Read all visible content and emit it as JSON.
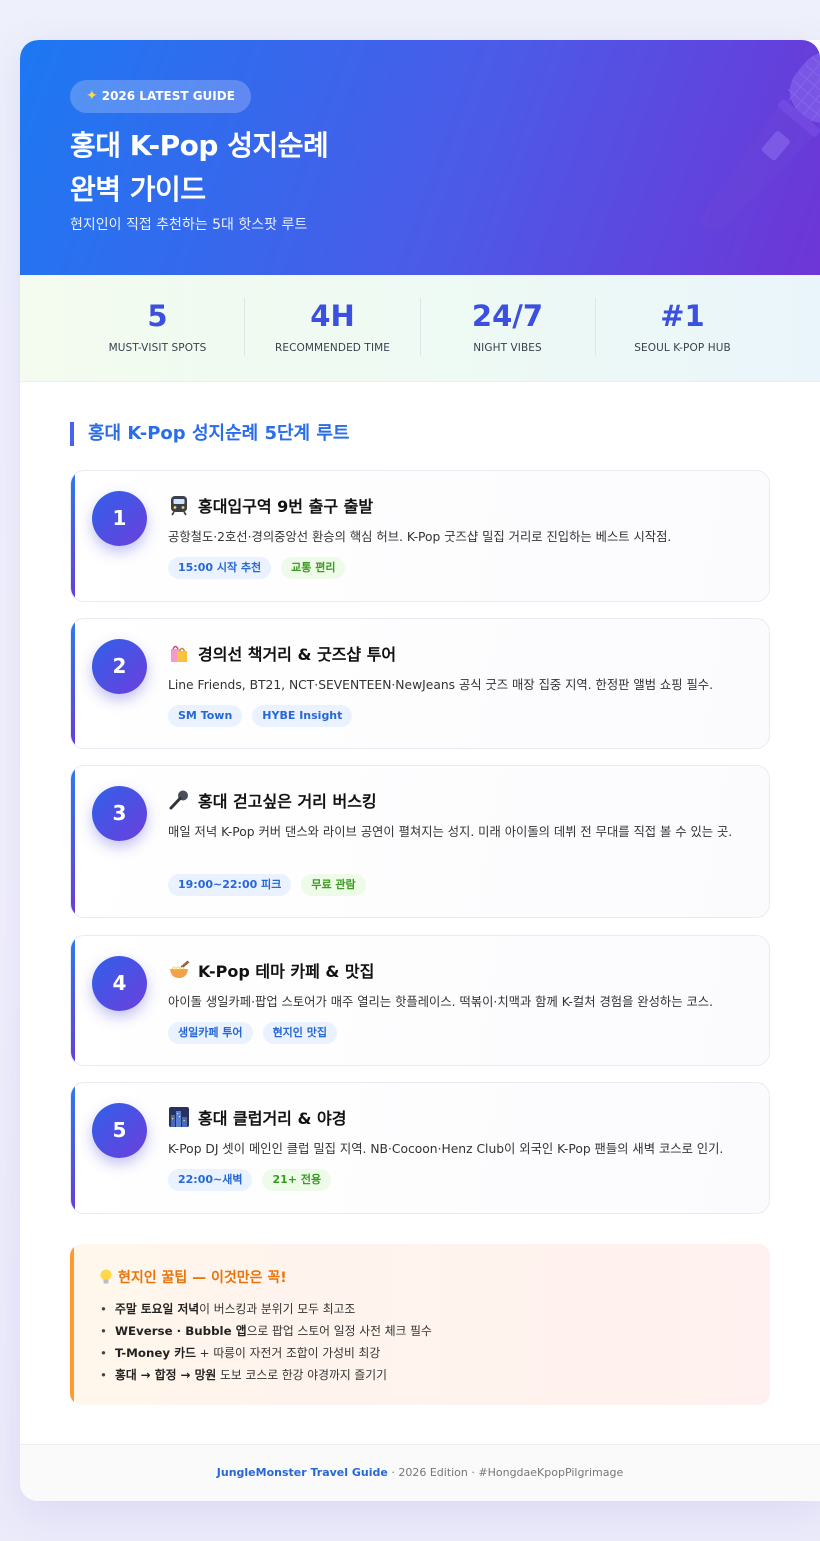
{
  "hero": {
    "badge": "2026 LATEST GUIDE",
    "title_line1": "홍대 K-Pop 성지순례",
    "title_line2": "완벽 가이드",
    "subtitle": "현지인이 직접 추천하는 5대 핫스팟 루트"
  },
  "stats": [
    {
      "value": "5",
      "label": "MUST-VISIT SPOTS"
    },
    {
      "value": "4H",
      "label": "RECOMMENDED TIME"
    },
    {
      "value": "24/7",
      "label": "NIGHT VIBES"
    },
    {
      "value": "#1",
      "label": "SEOUL K-POP HUB"
    }
  ],
  "section_title": "홍대 K-Pop 성지순례 5단계 루트",
  "steps": [
    {
      "num": "1",
      "icon": "subway-icon",
      "title": "홍대입구역 9번 출구 출발",
      "desc": "공항철도·2호선·경의중앙선 환승의 핵심 허브. K-Pop 굿즈샵 밀집 거리로 진입하는 베스트 시작점.",
      "tags": [
        "15:00 시작 추천",
        "교통 편리"
      ]
    },
    {
      "num": "2",
      "icon": "shopping-bags-icon",
      "title": "경의선 책거리 & 굿즈샵 투어",
      "desc": "Line Friends, BT21, NCT·SEVENTEEN·NewJeans 공식 굿즈 매장 집중 지역. 한정판 앨범 쇼핑 필수.",
      "tags": [
        "SM Town",
        "HYBE Insight"
      ]
    },
    {
      "num": "3",
      "icon": "microphone-icon",
      "title": "홍대 걷고싶은 거리 버스킹",
      "desc": "매일 저녁 K-Pop 커버 댄스와 라이브 공연이 펼쳐지는 성지. 미래 아이돌의 데뷔 전 무대를 직접 볼 수 있는 곳.",
      "tags": [
        "19:00~22:00 피크",
        "무료 관람"
      ]
    },
    {
      "num": "4",
      "icon": "noodle-bowl-icon",
      "title": "K-Pop 테마 카페 & 맛집",
      "desc": "아이돌 생일카페·팝업 스토어가 매주 열리는 핫플레이스. 떡볶이·치맥과 함께 K-컬처 경험을 완성하는 코스.",
      "tags": [
        "생일카페 투어",
        "현지인 맛집"
      ]
    },
    {
      "num": "5",
      "icon": "night-city-icon",
      "title": "홍대 클럽거리 & 야경",
      "desc": "K-Pop DJ 셋이 메인인 클럽 밀집 지역. NB·Cocoon·Henz Club이 외국인 K-Pop 팬들의 새벽 코스로 인기.",
      "tags": [
        "22:00~새벽",
        "21+ 전용"
      ]
    }
  ],
  "tips": {
    "title": "현지인 꿀팁 — 이것만은 꼭!",
    "items": [
      {
        "bold": "주말 토요일 저녁",
        "rest": "이 버스킹과 분위기 모두 최고조"
      },
      {
        "bold": "WEverse · Bubble 앱",
        "rest": "으로 팝업 스토어 일정 사전 체크 필수"
      },
      {
        "bold": "T-Money 카드",
        "rest": " + 따릉이 자전거 조합이 가성비 최강"
      },
      {
        "bold": "홍대 → 합정 → 망원",
        "rest": " 도보 코스로 한강 야경까지 즐기기"
      }
    ]
  },
  "footer": {
    "brand": "JungleMonster Travel Guide",
    "rest": " · 2026 Edition · #HongdaeKpopPilgrimage"
  },
  "colors": {
    "accent": "#3b4fe0",
    "hero_start": "#1d78f2",
    "hero_end": "#6e35d6",
    "tip_orange": "#e8740c"
  }
}
